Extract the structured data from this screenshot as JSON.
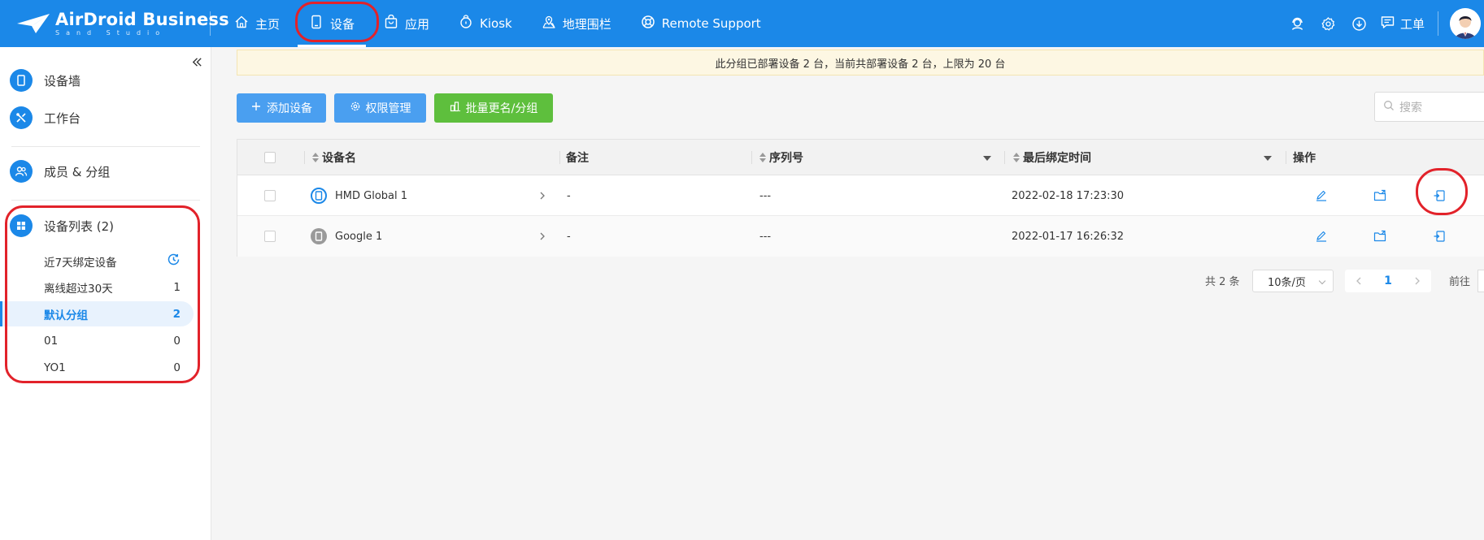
{
  "brand": {
    "title": "AirDroid Business",
    "subtitle": "Sand Studio"
  },
  "nav": {
    "items": [
      {
        "label": "主页",
        "icon": "home-icon",
        "active": false
      },
      {
        "label": "设备",
        "icon": "device-icon",
        "active": true
      },
      {
        "label": "应用",
        "icon": "app-bag-icon",
        "active": false
      },
      {
        "label": "Kiosk",
        "icon": "kiosk-lock-icon",
        "active": false
      },
      {
        "label": "地理围栏",
        "icon": "geofence-icon",
        "active": false
      },
      {
        "label": "Remote Support",
        "icon": "lifebuoy-icon",
        "active": false
      }
    ]
  },
  "topright": {
    "icons": [
      "support-agent-icon",
      "settings-gear-icon",
      "download-icon"
    ],
    "ticket_label": "工单",
    "ticket_icon": "chat-ticket-icon"
  },
  "sidebar": {
    "items": [
      {
        "label": "设备墙",
        "icon": "device-wall-icon"
      },
      {
        "label": "工作台",
        "icon": "tools-icon"
      },
      {
        "label": "成员 & 分组",
        "icon": "members-icon"
      },
      {
        "label": "设备列表 (2)",
        "icon": "device-list-grid-icon"
      }
    ],
    "groups": [
      {
        "label": "近7天绑定设备",
        "count": "",
        "icon": "recent-clock-icon",
        "active": false
      },
      {
        "label": "离线超过30天",
        "count": "1",
        "active": false
      },
      {
        "label": "默认分组",
        "count": "2",
        "active": true
      },
      {
        "label": "01",
        "count": "0",
        "active": false
      },
      {
        "label": "YO1",
        "count": "0",
        "active": false
      }
    ]
  },
  "banner": {
    "text": "此分组已部署设备 2 台，当前共部署设备 2 台，上限为 20 台"
  },
  "toolbar": {
    "add_device": "添加设备",
    "permission": "权限管理",
    "batch_rename": "批量更名/分组",
    "search_placeholder": "搜索"
  },
  "table": {
    "columns": {
      "name": "设备名",
      "remark": "备注",
      "serial": "序列号",
      "last_bind": "最后绑定时间",
      "actions": "操作"
    },
    "rows": [
      {
        "name": "HMD Global 1",
        "remark": "-",
        "serial": "---",
        "last_bind": "2022-02-18 17:23:30",
        "online": true
      },
      {
        "name": "Google 1",
        "remark": "-",
        "serial": "---",
        "last_bind": "2022-01-17 16:26:32",
        "online": false
      }
    ],
    "row_actions": [
      "edit-pen-icon",
      "move-folder-icon",
      "device-transfer-icon"
    ]
  },
  "pagination": {
    "total": "共 2 条",
    "page_size": "10条/页",
    "current": "1",
    "goto_label": "前往"
  },
  "colors": {
    "primary": "#1b88e8",
    "button_blue": "#4a9ff0",
    "button_green": "#5ebf3d",
    "annotation_red": "#e2222a",
    "banner_bg": "#fdf7e3"
  }
}
